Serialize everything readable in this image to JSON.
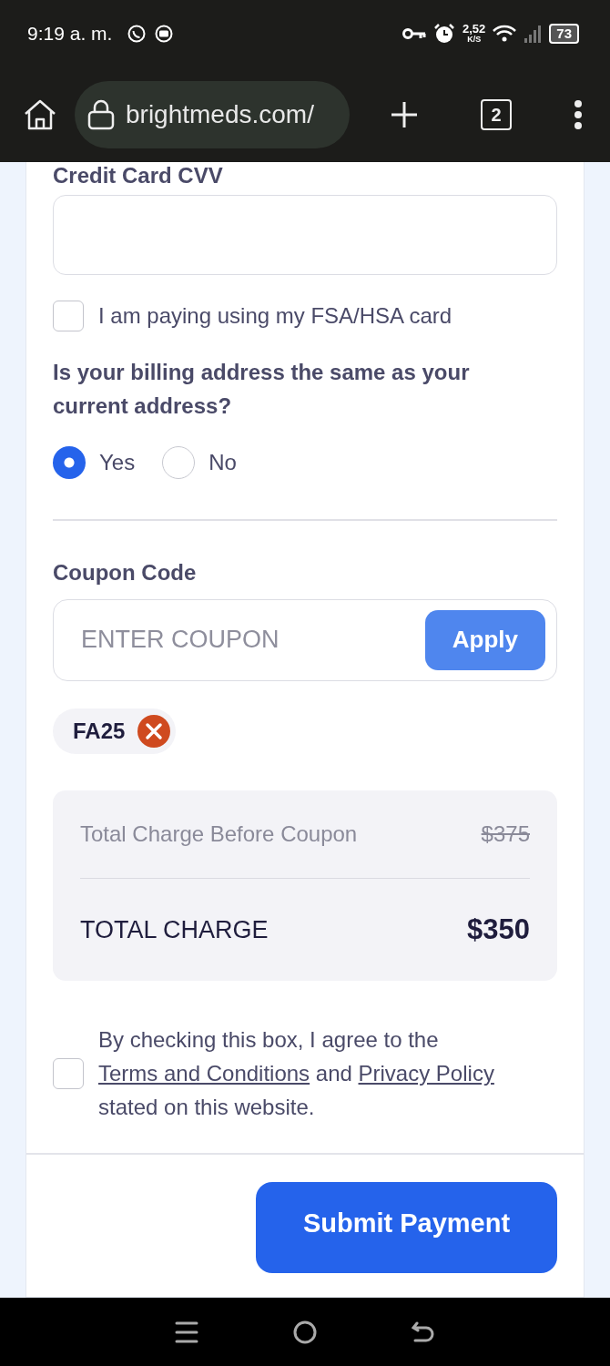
{
  "status_bar": {
    "time": "9:19 a. m.",
    "network_speed": "2,52",
    "speed_unit": "K/S",
    "battery": "73"
  },
  "browser": {
    "url": "brightmeds.com/",
    "tab_count": "2"
  },
  "cvv": {
    "label": "Credit Card CVV"
  },
  "fsa": {
    "label": "I am paying using my FSA/HSA card",
    "checked": false
  },
  "billing": {
    "question": "Is your billing address the same as your current address?",
    "options": [
      {
        "label": "Yes",
        "selected": true
      },
      {
        "label": "No",
        "selected": false
      }
    ]
  },
  "coupon": {
    "label": "Coupon Code",
    "placeholder": "ENTER COUPON",
    "button": "Apply"
  },
  "applied_coupons": [
    {
      "code": "FA25"
    }
  ],
  "summary": {
    "before_label": "Total Charge Before Coupon",
    "before_amount": "$375",
    "total_label": "TOTAL CHARGE",
    "total_amount": "$350"
  },
  "terms": {
    "checked": false,
    "text_before": "By checking this box, I agree to the ",
    "terms_link": "Terms and Conditions",
    "text_middle": " and ",
    "privacy_link": "Privacy Policy",
    "text_after": " stated on this website."
  },
  "submit": "Submit Payment"
}
